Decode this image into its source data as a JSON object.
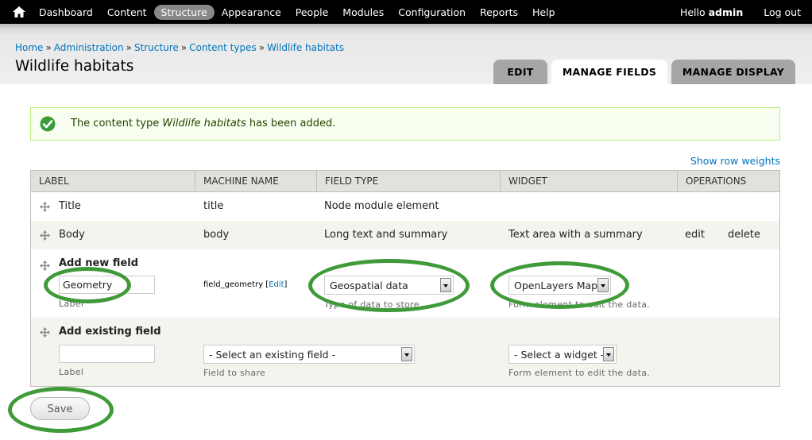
{
  "toolbar": {
    "home_icon": "home-icon",
    "menu": [
      {
        "label": "Dashboard",
        "active": false
      },
      {
        "label": "Content",
        "active": false
      },
      {
        "label": "Structure",
        "active": true
      },
      {
        "label": "Appearance",
        "active": false
      },
      {
        "label": "People",
        "active": false
      },
      {
        "label": "Modules",
        "active": false
      },
      {
        "label": "Configuration",
        "active": false
      },
      {
        "label": "Reports",
        "active": false
      },
      {
        "label": "Help",
        "active": false
      }
    ],
    "hello_prefix": "Hello",
    "username": "admin",
    "logout_label": "Log out"
  },
  "breadcrumb": {
    "items": [
      "Home",
      "Administration",
      "Structure",
      "Content types",
      "Wildlife habitats"
    ],
    "separator": "»"
  },
  "page_title": "Wildlife habitats",
  "tabs": [
    {
      "label": "EDIT",
      "active": false
    },
    {
      "label": "MANAGE FIELDS",
      "active": true
    },
    {
      "label": "MANAGE DISPLAY",
      "active": false
    }
  ],
  "status": {
    "icon": "check-circle-icon",
    "prefix": "The content type",
    "type_name": "Wildlife habitats",
    "suffix": "has been added."
  },
  "show_row_weights": "Show row weights",
  "table": {
    "headers": [
      "LABEL",
      "MACHINE NAME",
      "FIELD TYPE",
      "WIDGET",
      "OPERATIONS"
    ],
    "rows": [
      {
        "label": "Title",
        "machine": "title",
        "type": "Node module element"
      },
      {
        "label": "Body",
        "machine": "body",
        "type": "Long text and summary",
        "widget": "Text area with a summary",
        "edit": "edit",
        "delete": "delete"
      }
    ],
    "add_new": {
      "title": "Add new field",
      "label_value": "Geometry",
      "label_desc": "Label",
      "machine_name": "field_geometry",
      "machine_edit": "Edit",
      "type_value": "Geospatial data",
      "type_desc": "Type of data to store.",
      "widget_value": "OpenLayers Map",
      "widget_desc": "Form element to edit the data."
    },
    "add_existing": {
      "title": "Add existing field",
      "label_value": "",
      "label_desc": "Label",
      "field_value": "- Select an existing field -",
      "field_desc": "Field to share",
      "widget_value": "- Select a widget -",
      "widget_desc": "Form element to edit the data."
    }
  },
  "save_label": "Save",
  "colors": {
    "toolbar_bg": "#000000",
    "link": "#0074bd",
    "annotation": "#3f9b3a",
    "status_border": "#bbee77"
  }
}
